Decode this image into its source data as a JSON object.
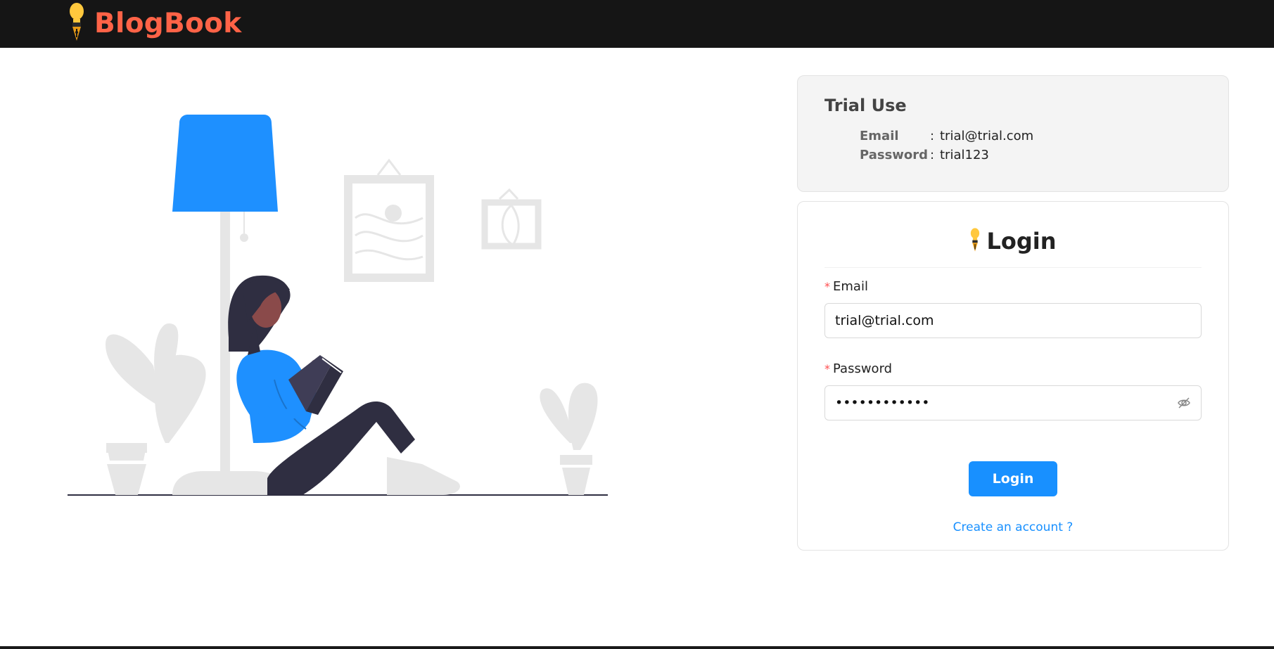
{
  "app": {
    "brand_name": "BlogBook",
    "brand_color": "#ff6347",
    "logo_icon": "lightbulb-pen-icon"
  },
  "trial": {
    "title": "Trial Use",
    "rows": [
      {
        "key": "Email",
        "sep": ":",
        "value": "trial@trial.com"
      },
      {
        "key": "Password",
        "sep": ":",
        "value": "trial123"
      }
    ]
  },
  "login": {
    "title": "Login",
    "email_label": "Email",
    "email_value": "trial@trial.com",
    "password_label": "Password",
    "password_value": "••••••••••••",
    "required_mark": "*",
    "submit_label": "Login",
    "create_account": "Create an account ?",
    "eye_icon": "eye-invisible-icon"
  },
  "colors": {
    "accent": "#1890ff",
    "navbar": "#151515",
    "lamp": "#1e90ff",
    "illustration_gray": "#e6e6e6"
  }
}
